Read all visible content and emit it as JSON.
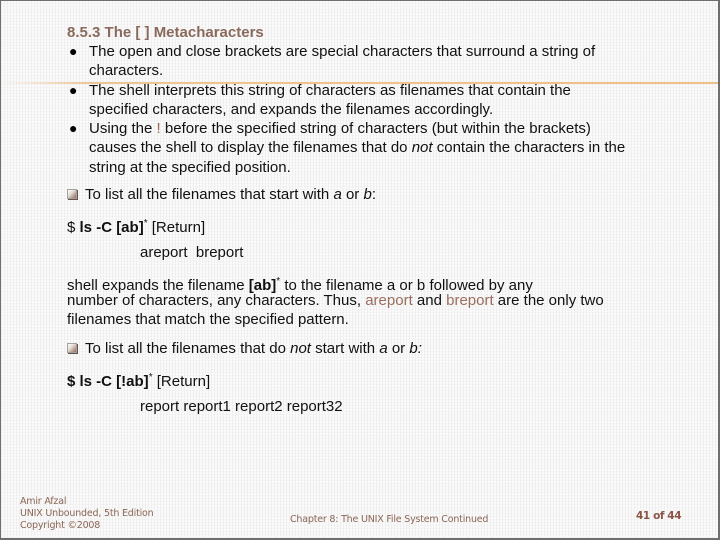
{
  "slide": {
    "title": "8.5.3 The [ ] Metacharacters",
    "accent_color": "#efc088",
    "title_color": "#8a6a5c",
    "bullets": [
      {
        "text": "The open and close brackets are special characters that surround a string of characters."
      },
      {
        "text": "The shell interprets this string of characters as filenames that contain the specified characters, and expands the filenames accordingly."
      },
      {
        "pre": "Using the ",
        "highlight": "!",
        "mid": " before the specified string of characters (but within the brackets) causes the shell to display the filenames that do ",
        "emphasis": "not",
        "post": " contain the characters in the string at the specified position."
      }
    ],
    "example1": {
      "intro_pre": "To list all the filenames that start with ",
      "intro_a": "a",
      "intro_or": " or ",
      "intro_b": "b",
      "intro_post": ":",
      "prompt": "$ ",
      "command": "ls -C [ab]",
      "star": "*",
      "return_label": " [Return]",
      "output": "areport  breport"
    },
    "explanation": {
      "line1_pre": "shell expands the filename ",
      "line1_bold": "[ab]",
      "line1_star": "*",
      "line1_post": " to the filename a or b followed by any",
      "line2_pre": "number of characters, any characters. Thus, ",
      "line2_hl1": "areport",
      "line2_and": " and ",
      "line2_hl2": "breport",
      "line2_post": " are the only two",
      "line3": "filenames that match the specified pattern."
    },
    "example2": {
      "intro_pre": "To list all the filenames that do ",
      "intro_not": "not",
      "intro_mid": " start with ",
      "intro_a": "a",
      "intro_or": " or ",
      "intro_b": "b:",
      "command": "$ ls -C [!ab]",
      "star": "*",
      "return_label": " [Return]",
      "output": "report report1 report2 report32"
    }
  },
  "footer": {
    "author": "Amir Afzal",
    "book": "UNIX Unbounded, 5th Edition",
    "copyright": "Copyright ©2008",
    "chapter": "Chapter 8: The UNIX File System Continued",
    "page": "41 of 44"
  }
}
